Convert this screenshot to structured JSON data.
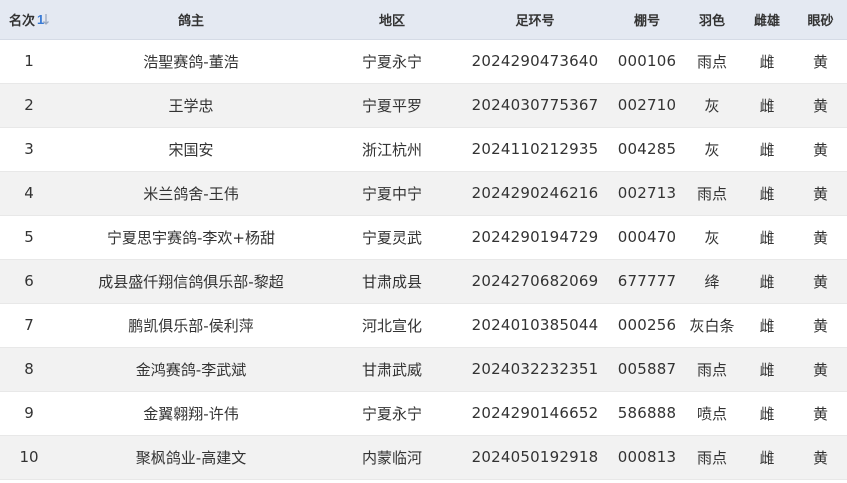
{
  "table": {
    "headers": {
      "rank": "名次",
      "owner": "鸽主",
      "region": "地区",
      "ring": "足环号",
      "shed": "棚号",
      "color": "羽色",
      "sex": "雌雄",
      "eye": "眼砂"
    },
    "sort_indicator": "1",
    "rows": [
      {
        "rank": "1",
        "owner": "浩聖赛鸽-董浩",
        "region": "宁夏永宁",
        "ring": "2024290473640",
        "shed": "000106",
        "color": "雨点",
        "sex": "雌",
        "eye": "黄"
      },
      {
        "rank": "2",
        "owner": "王学忠",
        "region": "宁夏平罗",
        "ring": "2024030775367",
        "shed": "002710",
        "color": "灰",
        "sex": "雌",
        "eye": "黄"
      },
      {
        "rank": "3",
        "owner": "宋国安",
        "region": "浙江杭州",
        "ring": "2024110212935",
        "shed": "004285",
        "color": "灰",
        "sex": "雌",
        "eye": "黄"
      },
      {
        "rank": "4",
        "owner": "米兰鸽舍-王伟",
        "region": "宁夏中宁",
        "ring": "2024290246216",
        "shed": "002713",
        "color": "雨点",
        "sex": "雌",
        "eye": "黄"
      },
      {
        "rank": "5",
        "owner": "宁夏思宇赛鸽-李欢+杨甜",
        "region": "宁夏灵武",
        "ring": "2024290194729",
        "shed": "000470",
        "color": "灰",
        "sex": "雌",
        "eye": "黄"
      },
      {
        "rank": "6",
        "owner": "成县盛仟翔信鸽俱乐部-黎超",
        "region": "甘肃成县",
        "ring": "2024270682069",
        "shed": "677777",
        "color": "绛",
        "sex": "雌",
        "eye": "黄"
      },
      {
        "rank": "7",
        "owner": "鹏凯俱乐部-侯利萍",
        "region": "河北宣化",
        "ring": "2024010385044",
        "shed": "000256",
        "color": "灰白条",
        "sex": "雌",
        "eye": "黄"
      },
      {
        "rank": "8",
        "owner": "金鸿赛鸽-李武斌",
        "region": "甘肃武威",
        "ring": "2024032232351",
        "shed": "005887",
        "color": "雨点",
        "sex": "雌",
        "eye": "黄"
      },
      {
        "rank": "9",
        "owner": "金翼翱翔-许伟",
        "region": "宁夏永宁",
        "ring": "2024290146652",
        "shed": "586888",
        "color": "喷点",
        "sex": "雌",
        "eye": "黄"
      },
      {
        "rank": "10",
        "owner": "聚枫鸽业-高建文",
        "region": "内蒙临河",
        "ring": "2024050192918",
        "shed": "000813",
        "color": "雨点",
        "sex": "雌",
        "eye": "黄"
      }
    ]
  },
  "colors": {
    "header_bg": "#e4e9f2",
    "row_alt_bg": "#f2f2f2",
    "sort_accent": "#3a7bd5",
    "sort_muted": "#9aa9c0"
  },
  "icons": {
    "sort": "sort-icon"
  }
}
